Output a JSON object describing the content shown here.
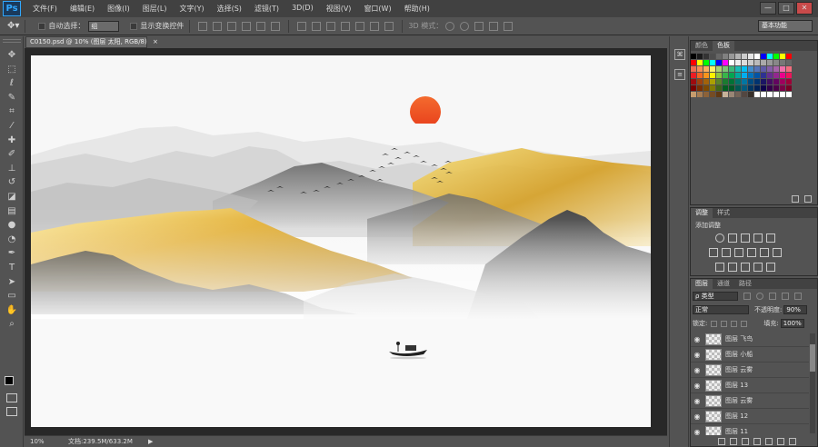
{
  "app": {
    "logo": "Ps"
  },
  "menu": [
    "文件(F)",
    "编辑(E)",
    "图像(I)",
    "图层(L)",
    "文字(Y)",
    "选择(S)",
    "滤镜(T)",
    "3D(D)",
    "视图(V)",
    "窗口(W)",
    "帮助(H)"
  ],
  "window_controls": {
    "minimize": "—",
    "maximize": "□",
    "close": "✕"
  },
  "options": {
    "auto_select_label": "自动选择：",
    "auto_select_value": "组",
    "show_transform_label": "显示变换控件",
    "mode3d_label": "3D 模式：",
    "workspace": "基本功能"
  },
  "document": {
    "tab_title": "C0150.psd @ 10% (图层 太阳, RGB/8)",
    "tab_close": "×",
    "zoom": "10%",
    "doc_info": "文档:239.5M/633.2M",
    "status_arrow": "▶"
  },
  "tools": [
    {
      "name": "move-tool",
      "glyph": "✥"
    },
    {
      "name": "marquee-tool",
      "glyph": "⬚"
    },
    {
      "name": "lasso-tool",
      "glyph": "ℓ"
    },
    {
      "name": "quick-select-tool",
      "glyph": "✎"
    },
    {
      "name": "crop-tool",
      "glyph": "⌗"
    },
    {
      "name": "eyedropper-tool",
      "glyph": "⁄"
    },
    {
      "name": "healing-tool",
      "glyph": "✚"
    },
    {
      "name": "brush-tool",
      "glyph": "✐"
    },
    {
      "name": "stamp-tool",
      "glyph": "⊥"
    },
    {
      "name": "history-brush-tool",
      "glyph": "↺"
    },
    {
      "name": "eraser-tool",
      "glyph": "◪"
    },
    {
      "name": "gradient-tool",
      "glyph": "▤"
    },
    {
      "name": "blur-tool",
      "glyph": "●"
    },
    {
      "name": "dodge-tool",
      "glyph": "◔"
    },
    {
      "name": "pen-tool",
      "glyph": "✒"
    },
    {
      "name": "type-tool",
      "glyph": "T"
    },
    {
      "name": "path-select-tool",
      "glyph": "➤"
    },
    {
      "name": "shape-tool",
      "glyph": "▭"
    },
    {
      "name": "hand-tool",
      "glyph": "✋"
    },
    {
      "name": "zoom-tool",
      "glyph": "⌕"
    }
  ],
  "swatches_panel": {
    "tabs": [
      "颜色",
      "色板"
    ],
    "colors": [
      "#000000",
      "#1a1a1a",
      "#333333",
      "#4d4d4d",
      "#666666",
      "#808080",
      "#999999",
      "#b3b3b3",
      "#cccccc",
      "#e6e6e6",
      "#ffffff",
      "#0000ff",
      "#00ffff",
      "#00ff00",
      "#ffff00",
      "#ff0000",
      "#ff0000",
      "#ffff00",
      "#00ff00",
      "#00ffff",
      "#0000ff",
      "#ff00ff",
      "#ffffff",
      "#eeeeee",
      "#dddddd",
      "#cccccc",
      "#bbbbbb",
      "#aaaaaa",
      "#999999",
      "#888888",
      "#777777",
      "#666666",
      "#f26c4f",
      "#f68e55",
      "#fbaf5c",
      "#fff467",
      "#acd372",
      "#7cc576",
      "#3bb878",
      "#1abbb4",
      "#00bff3",
      "#438ccb",
      "#5574b9",
      "#605ca8",
      "#855fa8",
      "#a763a9",
      "#f06ea9",
      "#f26d7d",
      "#ed1c24",
      "#f26522",
      "#f7941d",
      "#fff200",
      "#8dc63f",
      "#39b54a",
      "#00a651",
      "#00a99d",
      "#00aeef",
      "#0072bc",
      "#0054a6",
      "#2e3192",
      "#662d91",
      "#92278f",
      "#ec008c",
      "#ed145b",
      "#9e0b0f",
      "#a0410d",
      "#a36209",
      "#aba000",
      "#598527",
      "#1a7b30",
      "#007236",
      "#00746b",
      "#0076a3",
      "#004b80",
      "#003471",
      "#1b1464",
      "#440e62",
      "#630460",
      "#9e005d",
      "#9e0039",
      "#790000",
      "#7b2e00",
      "#7d4900",
      "#827b00",
      "#406618",
      "#005e20",
      "#005826",
      "#005952",
      "#005b7f",
      "#003663",
      "#002157",
      "#0d004c",
      "#32004b",
      "#4b0049",
      "#7b0046",
      "#7a0026",
      "#c69c6d",
      "#a67c52",
      "#8c6239",
      "#754c24",
      "#603913",
      "#c7b299",
      "#998675",
      "#736357",
      "#534741",
      "#37302a",
      "#ffffff",
      "#ffffff",
      "#ffffff",
      "#ffffff",
      "#ffffff",
      "#ffffff"
    ]
  },
  "adjustments_panel": {
    "tabs": [
      "调整",
      "样式"
    ],
    "title": "添加调整"
  },
  "layers_panel": {
    "tabs": [
      "图层",
      "通道",
      "路径"
    ],
    "filter_label": "ρ 类型",
    "blend_mode": "正常",
    "opacity_label": "不透明度:",
    "opacity_value": "90%",
    "lock_label": "锁定:",
    "fill_label": "填充:",
    "fill_value": "100%",
    "layers": [
      {
        "name": "图层 飞鸟",
        "visible": true
      },
      {
        "name": "图层 小船",
        "visible": true
      },
      {
        "name": "图层 云雾",
        "visible": true
      },
      {
        "name": "图层 13",
        "visible": true
      },
      {
        "name": "图层 云雾",
        "visible": true
      },
      {
        "name": "图层 12",
        "visible": true
      },
      {
        "name": "图层 11",
        "visible": true
      }
    ],
    "footer_icons": [
      "link-icon",
      "fx-icon",
      "mask-icon",
      "adjustment-icon",
      "folder-icon",
      "new-layer-icon",
      "trash-icon"
    ]
  },
  "colors": {
    "sun": "#f05a28",
    "gold": "#e3b13a",
    "ui_dark": "#414141",
    "ui_mid": "#535353"
  }
}
